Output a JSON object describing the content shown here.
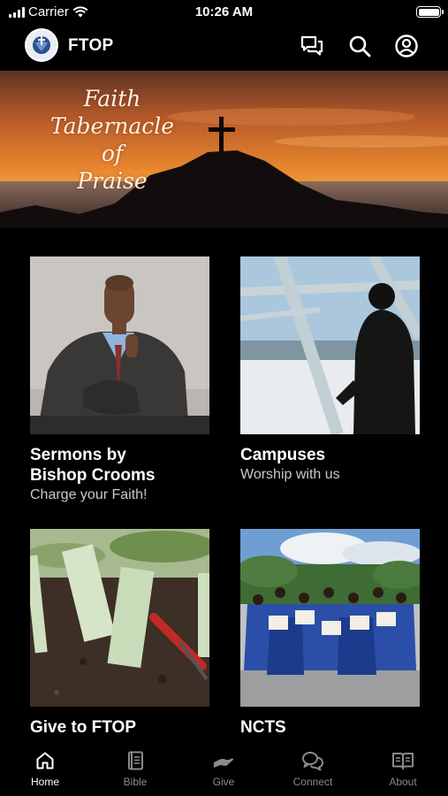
{
  "status_bar": {
    "carrier": "Carrier",
    "time": "10:26 AM"
  },
  "header": {
    "title": "FTOP",
    "icons": [
      "chat-icon",
      "search-icon",
      "profile-icon"
    ]
  },
  "banner": {
    "lines": [
      "Faith",
      "Tabernacle of",
      "Praise"
    ]
  },
  "tiles": [
    {
      "title_lines": [
        "Sermons by",
        "Bishop Crooms"
      ],
      "subtitle": "Charge your Faith!"
    },
    {
      "title_lines": [
        "Campuses"
      ],
      "subtitle": "Worship with us"
    },
    {
      "title_lines": [
        "Give to FTOP"
      ],
      "subtitle": ""
    },
    {
      "title_lines": [
        "NCTS"
      ],
      "subtitle": ""
    }
  ],
  "tab_bar": {
    "active": "Home",
    "items": [
      {
        "label": "Home",
        "icon": "home-icon"
      },
      {
        "label": "Bible",
        "icon": "bible-icon"
      },
      {
        "label": "Give",
        "icon": "give-icon"
      },
      {
        "label": "Connect",
        "icon": "connect-icon"
      },
      {
        "label": "About",
        "icon": "about-icon"
      }
    ]
  },
  "colors": {
    "background": "#000000",
    "active_tab": "#ffffff",
    "inactive_tab": "#8a8a8a",
    "subtitle": "#c9c9c9"
  }
}
